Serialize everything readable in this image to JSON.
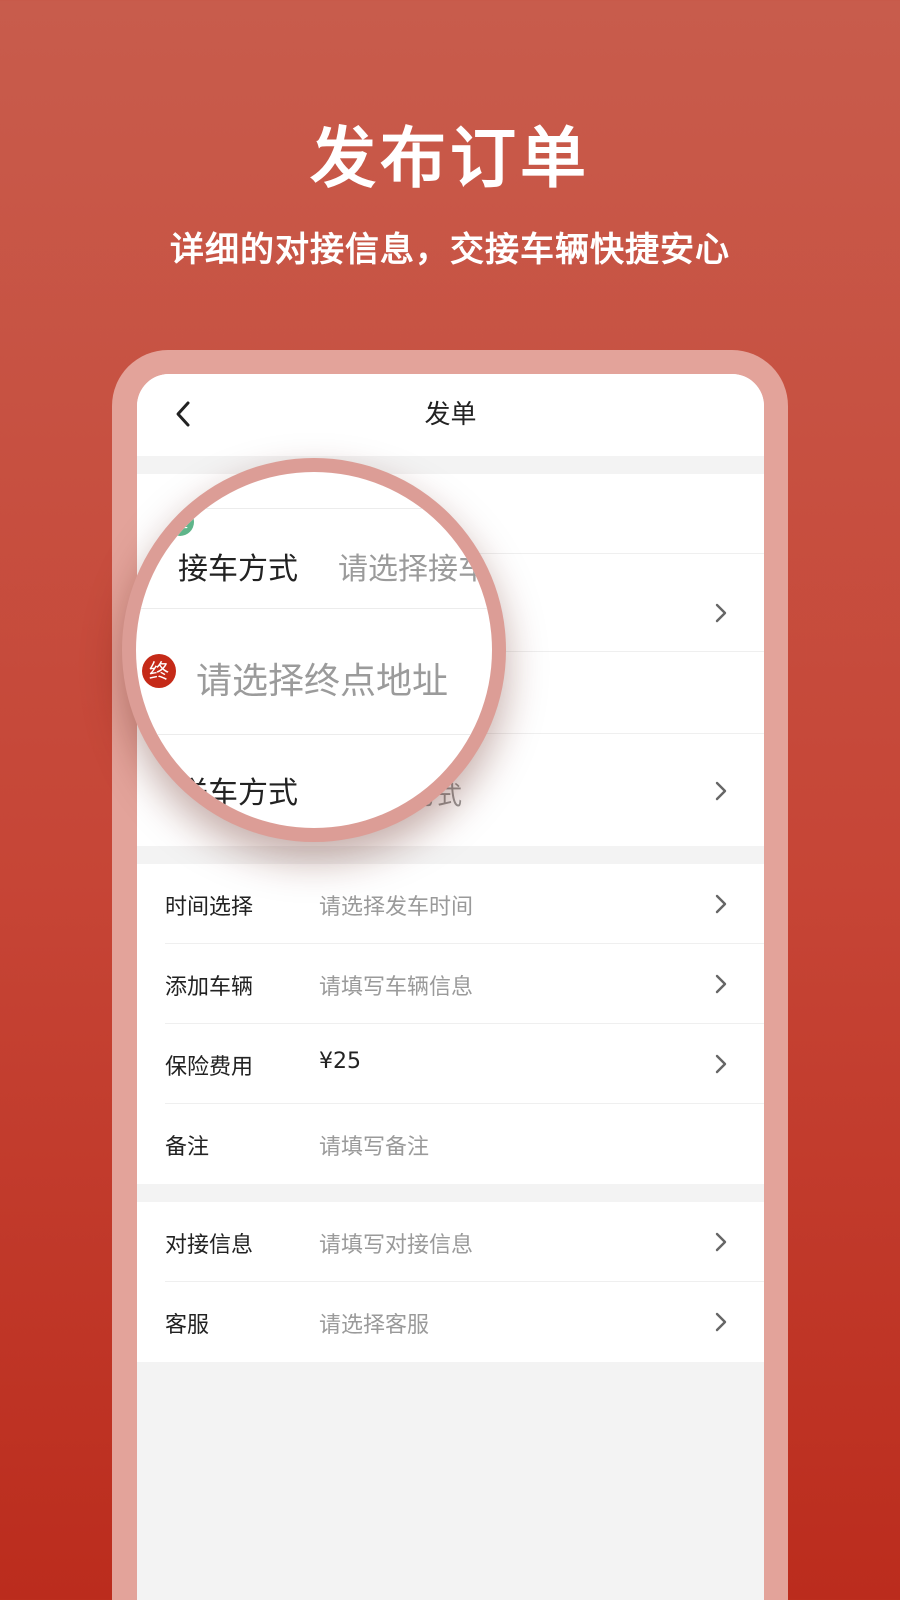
{
  "promo": {
    "title": "发布订单",
    "subtitle": "详细的对接信息，交接车辆快捷安心"
  },
  "nav": {
    "back_icon": "chevron-left-icon",
    "title": "发单"
  },
  "address": {
    "start_badge": "起",
    "end_badge": "终",
    "pickup_label": "接车方式",
    "pickup_placeholder": "请选择接车",
    "end_placeholder": "请选择终点地址",
    "delivery_label": "送车方式",
    "delivery_placeholder": "请选择方式"
  },
  "form": {
    "rows": [
      {
        "label": "时间选择",
        "value": "请选择发车时间",
        "filled": false,
        "chevron": true
      },
      {
        "label": "添加车辆",
        "value": "请填写车辆信息",
        "filled": false,
        "chevron": true
      },
      {
        "label": "保险费用",
        "value": "¥25",
        "filled": true,
        "chevron": true
      },
      {
        "label": "备注",
        "value": "请填写备注",
        "filled": false,
        "chevron": false
      }
    ]
  },
  "contact": {
    "rows": [
      {
        "label": "对接信息",
        "value": "请填写对接信息",
        "chevron": true
      },
      {
        "label": "客服",
        "value": "请选择客服",
        "chevron": true
      }
    ]
  },
  "colors": {
    "accent": "#c52a18",
    "start_badge": "#5fb58a"
  }
}
